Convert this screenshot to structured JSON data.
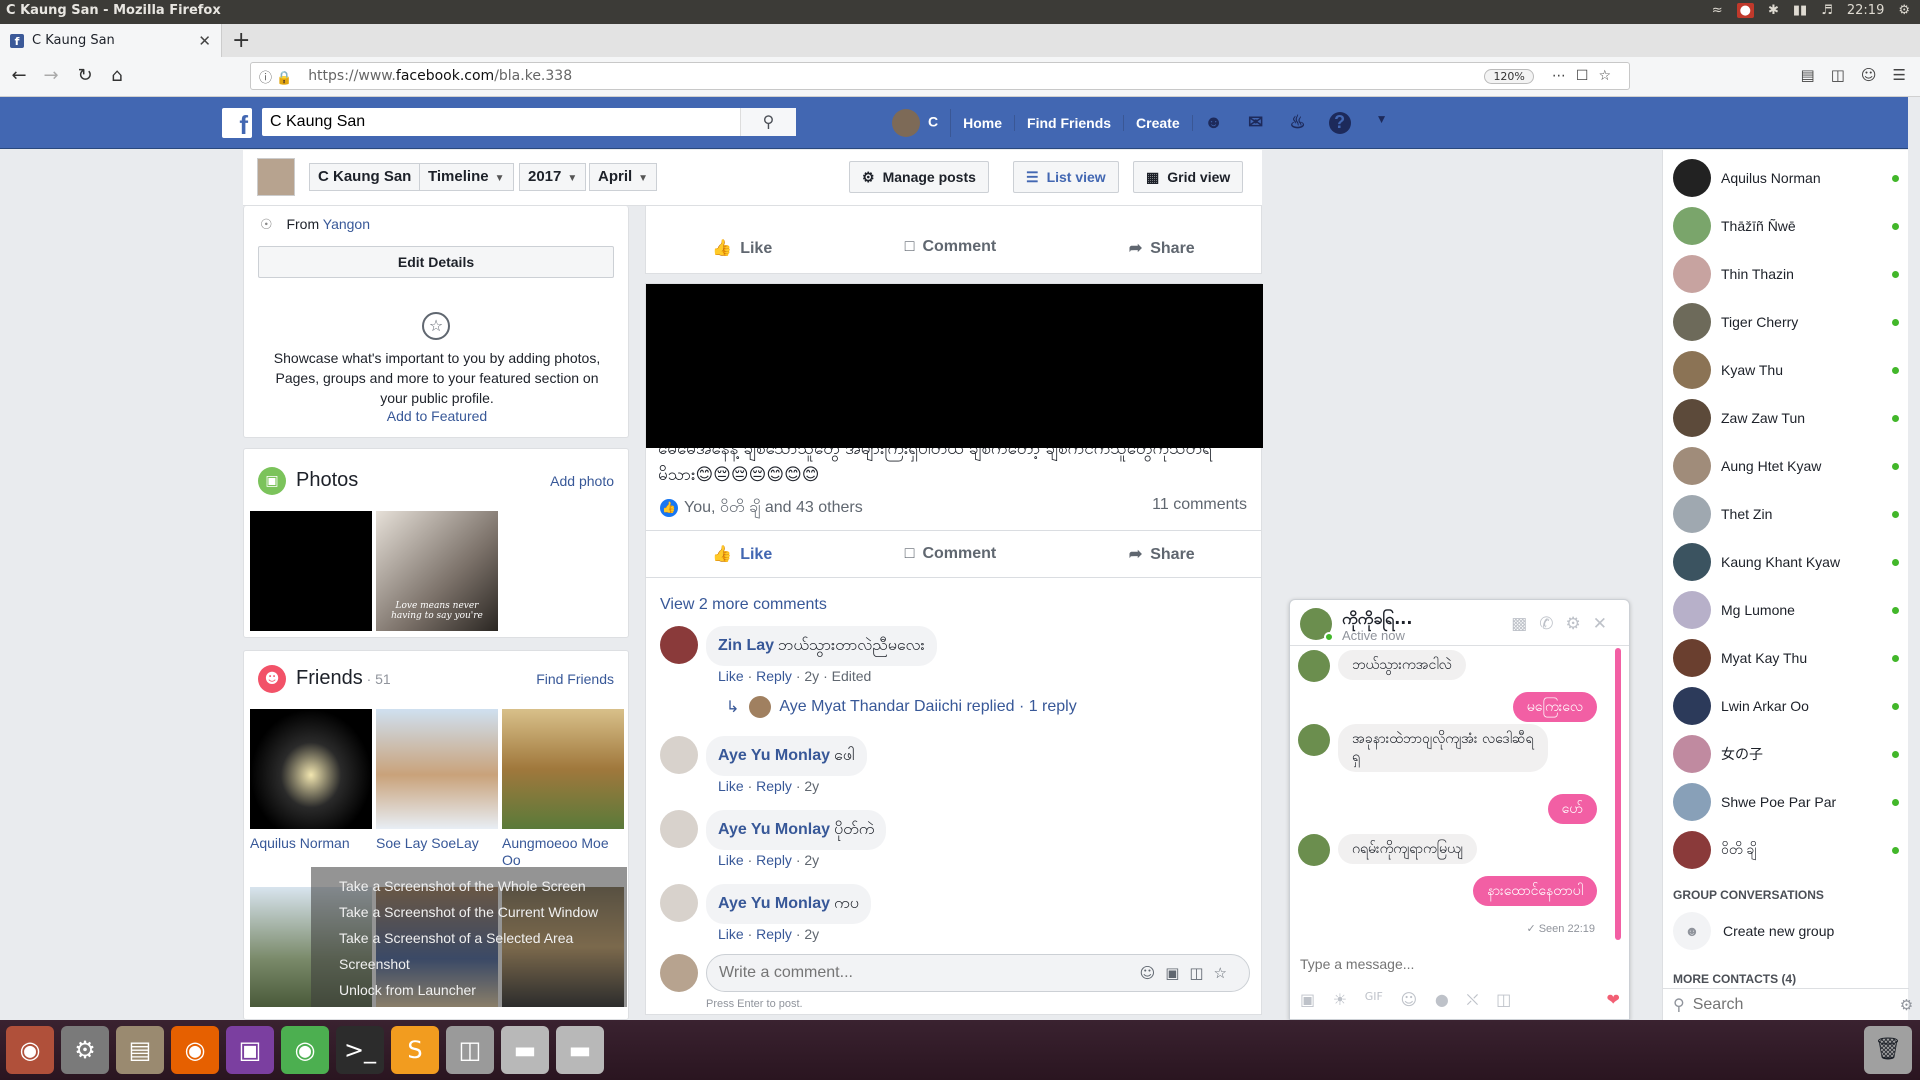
{
  "os": {
    "window_title": "C Kaung San - Mozilla Firefox",
    "clock": "22:19"
  },
  "browser": {
    "tab_title": "C Kaung San",
    "url_prefix": "https://www.",
    "url_domain": "facebook.com",
    "url_path": "/bla.ke.338",
    "zoom": "120%"
  },
  "fb": {
    "logo": "f",
    "search_value": "C Kaung San",
    "nav": {
      "profile": "C",
      "home": "Home",
      "find_friends": "Find Friends",
      "create": "Create"
    }
  },
  "timeline": {
    "name": "C Kaung San",
    "section": "Timeline",
    "year": "2017",
    "month": "April",
    "manage_posts": "Manage posts",
    "list_view": "List view",
    "grid_view": "Grid view"
  },
  "intro": {
    "from_label": "From",
    "from_place": "Yangon",
    "edit_details": "Edit Details",
    "featured_text": "Showcase what's important to you by adding photos, Pages, groups and more to your featured section on your public profile.",
    "featured_link": "Add to Featured"
  },
  "photos": {
    "title": "Photos",
    "add_photo": "Add photo",
    "caption": "Love means never having to say you're"
  },
  "friends": {
    "title": "Friends",
    "count": " · 51",
    "find_friends": "Find Friends",
    "list": [
      {
        "name": "Aquilus Norman"
      },
      {
        "name": "Soe Lay SoeLay"
      },
      {
        "name": "Aungmoeoo Moe Oo"
      }
    ]
  },
  "screenshot_menu": [
    "Take a Screenshot of the Whole Screen",
    "Take a Screenshot of the Current Window",
    "Take a Screenshot of a Selected Area",
    "Screenshot",
    "Unlock from Launcher"
  ],
  "post": {
    "actions_top": {
      "like": "Like",
      "comment": "Comment",
      "share": "Share"
    },
    "text": "မေမေအနေနဲ့ ချစ်သောသူတွေ အများကြီးရှိပါတယ် ချစ်ကတော့ ချစ်ကင်ကသူတွေကိုသတိရမိသား😊😔😔😔😊😊😊",
    "reactions": "You, ဝိတိ ချိ and 43 others",
    "comments_count": "11 comments",
    "actions": {
      "like": "Like",
      "comment": "Comment",
      "share": "Share"
    },
    "view_more": "View 2 more comments",
    "comments": [
      {
        "name": "Zin Lay",
        "text": "ဘယ်သွားတာလဲညီမလေး",
        "like": "Like",
        "reply": "Reply",
        "time": "2y",
        "edited": "Edited"
      },
      {
        "name": "Aye Yu Monlay",
        "text": "ဖေါ",
        "like": "Like",
        "reply": "Reply",
        "time": "2y"
      },
      {
        "name": "Aye Yu Monlay",
        "text": "ပိုတ်ကဲ",
        "like": "Like",
        "reply": "Reply",
        "time": "2y"
      },
      {
        "name": "Aye Yu Monlay",
        "text": "ကပ",
        "like": "Like",
        "reply": "Reply",
        "time": "2y"
      }
    ],
    "reply_summary": "Aye Myat Thandar Daiichi replied · 1 reply",
    "write_placeholder": "Write a comment...",
    "write_hint": "Press Enter to post."
  },
  "chat": {
    "name": "ကိုကိုခရြ...",
    "status": "Active now",
    "messages": [
      {
        "dir": "in",
        "text": "ဘယ်သွားကအငါလဲ"
      },
      {
        "dir": "out",
        "text": "မကြေးလေ"
      },
      {
        "dir": "in",
        "text": "အခုနားထဲဘာဝျလိုကျအံး လဒေါဆီရရှ"
      },
      {
        "dir": "out",
        "text": "ပော်"
      },
      {
        "dir": "in",
        "text": "ဂရမ်းကိုကျရာကမြယျ"
      },
      {
        "dir": "out",
        "text": "နားထောင်နေတာပါ"
      }
    ],
    "seen": "Seen 22:19",
    "input_placeholder": "Type a message..."
  },
  "sidebar": {
    "contacts": [
      {
        "name": "Aquilus Norman",
        "color": "#222222"
      },
      {
        "name": "Thāžīñ Ñwē",
        "color": "#7aa56b"
      },
      {
        "name": "Thin Thazin",
        "color": "#c7a3a0"
      },
      {
        "name": "Tiger Cherry",
        "color": "#6d6a5a"
      },
      {
        "name": "Kyaw Thu",
        "color": "#8b7355"
      },
      {
        "name": "Zaw Zaw Tun",
        "color": "#5c4a3a"
      },
      {
        "name": "Aung Htet Kyaw",
        "color": "#a08c7a"
      },
      {
        "name": "Thet Zin",
        "color": "#9fa8b0"
      },
      {
        "name": "Kaung Khant Kyaw",
        "color": "#3b5360"
      },
      {
        "name": "Mg Lumone",
        "color": "#b7b0c9"
      },
      {
        "name": "Myat Kay Thu",
        "color": "#6a3f2f"
      },
      {
        "name": "Lwin Arkar Oo",
        "color": "#2c3a5a"
      },
      {
        "name": "女の子",
        "color": "#c08aa0"
      },
      {
        "name": "Shwe Poe Par Par",
        "color": "#88a0b8"
      },
      {
        "name": "ဝိတိ ချိ",
        "color": "#8a3a3a"
      }
    ],
    "group_head": "GROUP CONVERSATIONS",
    "new_group": "Create new group",
    "more_contacts": "MORE CONTACTS (4)",
    "search_placeholder": "Search"
  }
}
